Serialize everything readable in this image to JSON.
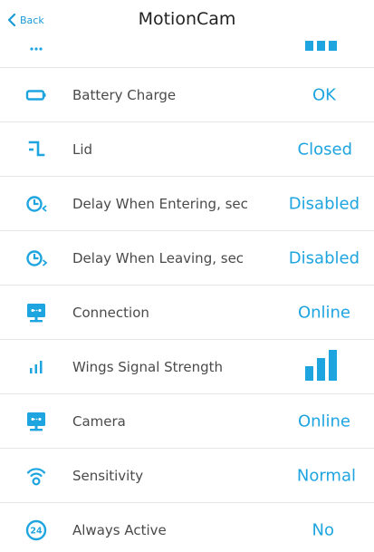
{
  "header": {
    "back_label": "Back",
    "title": "MotionCam"
  },
  "colors": {
    "accent": "#1ea5e0",
    "text": "#4a4a4a",
    "divider": "#e6e6e6"
  },
  "rows": [
    {
      "label": "",
      "value": "",
      "icon": "temperature-icon",
      "signal_bars": 3
    },
    {
      "label": "Battery Charge",
      "value": "OK",
      "icon": "battery-icon"
    },
    {
      "label": "Lid",
      "value": "Closed",
      "icon": "lid-icon"
    },
    {
      "label": "Delay When Entering, sec",
      "value": "Disabled",
      "icon": "delay-entering-icon"
    },
    {
      "label": "Delay When Leaving, sec",
      "value": "Disabled",
      "icon": "delay-leaving-icon"
    },
    {
      "label": "Connection",
      "value": "Online",
      "icon": "connection-icon"
    },
    {
      "label": "Wings Signal Strength",
      "value": "",
      "icon": "signal-icon",
      "signal_bars": 3
    },
    {
      "label": "Camera",
      "value": "Online",
      "icon": "camera-icon"
    },
    {
      "label": "Sensitivity",
      "value": "Normal",
      "icon": "sensitivity-icon"
    },
    {
      "label": "Always Active",
      "value": "No",
      "icon": "always-active-icon"
    }
  ]
}
